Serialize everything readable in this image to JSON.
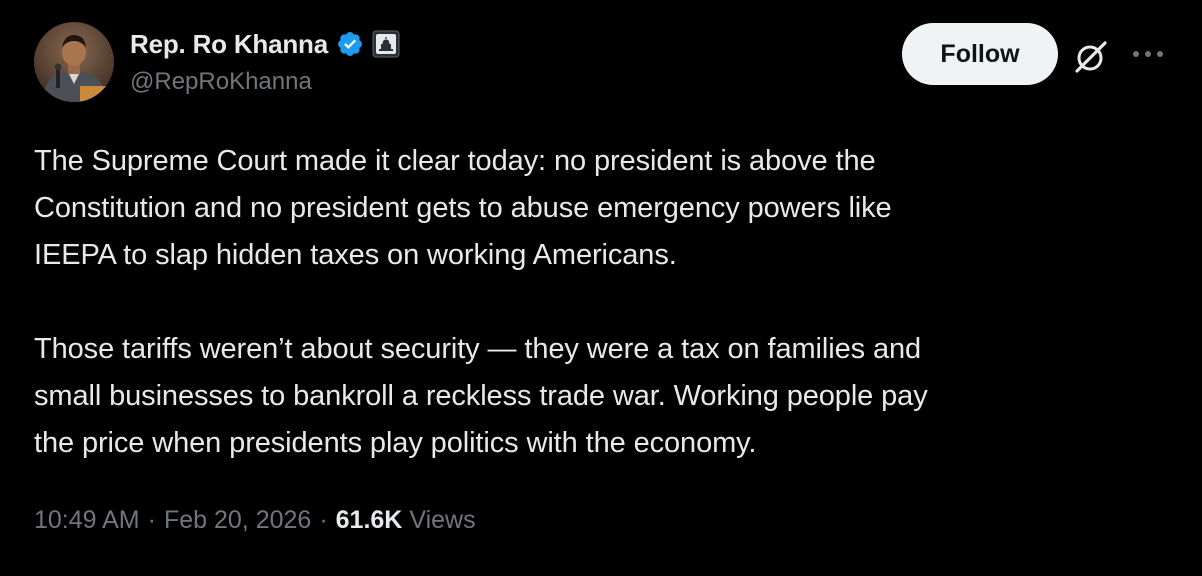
{
  "author": {
    "display_name": "Rep. Ro Khanna",
    "handle": "@RepRoKhanna",
    "verified_icon": "verified-check-icon",
    "affiliation_icon": "government-capitol-icon",
    "avatar_icon": "profile-photo"
  },
  "actions": {
    "follow_label": "Follow",
    "grok_icon": "grok-icon",
    "more_icon": "more-dots-icon"
  },
  "tweet": {
    "paragraphs": [
      "The Supreme Court made it clear today: no president is above the\nConstitution and no president gets to abuse emergency powers like\nIEEPA to slap hidden taxes on working Americans.",
      "Those tariffs weren’t about security — they were a tax on families and\nsmall businesses to bankroll a reckless trade war. Working people pay\nthe price when presidents play politics with the economy."
    ]
  },
  "meta": {
    "time": "10:49 AM",
    "separator": "·",
    "date": "Feb 20, 2026",
    "views_count": "61.6K",
    "views_label": "Views"
  },
  "colors": {
    "background": "#000000",
    "primary_text": "#e7e9ea",
    "secondary_text": "#71767b",
    "verified_blue": "#1d9bf0",
    "follow_bg": "#eff3f4",
    "follow_text": "#0f1419"
  }
}
